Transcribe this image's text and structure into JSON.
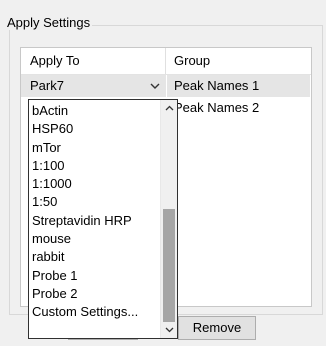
{
  "panel": {
    "title": "Apply Settings"
  },
  "table": {
    "headers": [
      "Apply To",
      "Group"
    ],
    "rows": [
      {
        "apply_to": "Park7",
        "group": "Peak Names 1"
      },
      {
        "apply_to": "",
        "group": "Peak Names 2"
      }
    ]
  },
  "dropdown": {
    "items": [
      "bActin",
      "HSP60",
      "mTor",
      "1:100",
      "1:1000",
      "1:50",
      "Streptavidin HRP",
      "mouse",
      "rabbit",
      "Probe 1",
      "Probe 2",
      "Custom Settings..."
    ],
    "scroll_fraction_visible": 0.55,
    "scroll_position": 0.45
  },
  "buttons": {
    "remove_label": "Remove"
  },
  "icons": {
    "combo_arrow": "chevron-down-icon",
    "scroll_up": "scroll-up-arrow-icon",
    "scroll_down": "scroll-down-arrow-icon"
  }
}
